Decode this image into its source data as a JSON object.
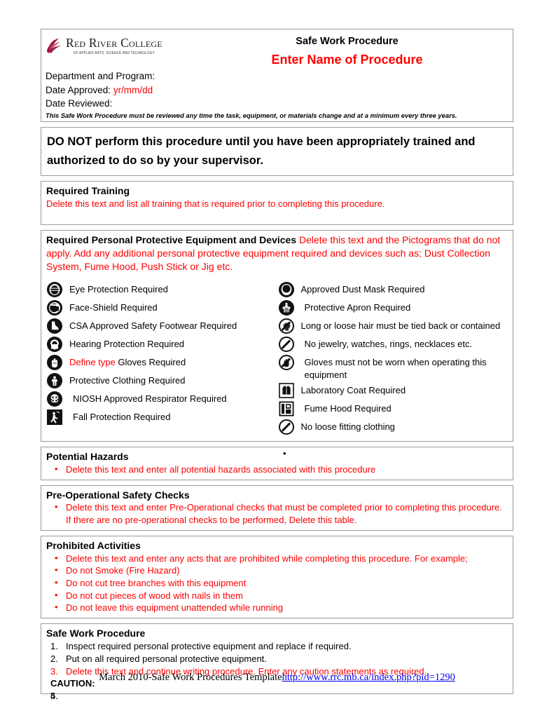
{
  "header": {
    "logo": {
      "name": "Red River College",
      "tagline": "OF APPLIED ARTS, SCIENCE AND TECHNOLOGY"
    },
    "title_main": "Safe Work Procedure",
    "title_sub": "Enter Name of Procedure",
    "department_label": "Department and Program:",
    "date_approved_label": "Date Approved:",
    "date_approved_value": "yr/mm/dd",
    "date_reviewed_label": "Date Reviewed:",
    "review_note": "This Safe Work Procedure must be reviewed any time the task, equipment, or materials change and at a minimum every three years."
  },
  "warning": {
    "text": "DO NOT perform this procedure until you have been appropriately trained and authorized to do so by your supervisor."
  },
  "required_training": {
    "heading": "Required Training",
    "body": "Delete this text and list all training that is required prior to completing this procedure."
  },
  "ppe": {
    "heading": "Required Personal Protective Equipment and Devices",
    "heading_note": "Delete this text and the Pictograms that do not apply.  Add any additional personal protective equipment required and devices such as; Dust Collection System, Fume Hood, Push Stick or Jig etc.",
    "left_items": [
      {
        "icon": "eye-protection-icon",
        "label": "Eye Protection Required"
      },
      {
        "icon": "face-shield-icon",
        "label": "Face-Shield Required"
      },
      {
        "icon": "safety-footwear-icon",
        "label": "CSA Approved Safety Footwear Required"
      },
      {
        "icon": "hearing-protection-icon",
        "label": "Hearing Protection Required"
      },
      {
        "icon": "gloves-required-icon",
        "label_red": "Define type",
        "label": " Gloves Required"
      },
      {
        "icon": "protective-clothing-icon",
        "label": "Protective Clothing Required"
      },
      {
        "icon": "respirator-icon",
        "label": "NIOSH Approved Respirator Required"
      },
      {
        "icon": "fall-protection-icon",
        "label": "Fall Protection Required"
      }
    ],
    "right_items": [
      {
        "icon": "dust-mask-icon",
        "label": "Approved Dust Mask Required"
      },
      {
        "icon": "protective-apron-icon",
        "label": "Protective Apron Required"
      },
      {
        "icon": "no-loose-hair-icon",
        "label": "Long or loose hair must be tied back or contained"
      },
      {
        "icon": "no-jewelry-icon",
        "label": "No jewelry, watches, rings, necklaces etc."
      },
      {
        "icon": "no-gloves-icon",
        "label": "Gloves must not be worn when  operating this equipment"
      },
      {
        "icon": "lab-coat-icon",
        "label": "Laboratory Coat Required"
      },
      {
        "icon": "fume-hood-icon",
        "label": "Fume Hood Required"
      },
      {
        "icon": "no-loose-clothing-icon",
        "label": "No loose fitting clothing"
      }
    ]
  },
  "potential_hazards": {
    "heading": "Potential Hazards",
    "stray_bullet": "•",
    "items": [
      "Delete this text and enter all potential hazards associated with this procedure"
    ]
  },
  "pre_operational": {
    "heading": "Pre-Operational Safety Checks",
    "items": [
      "Delete this text and enter Pre-Operational checks that must be completed prior to completing this procedure.  If there are no pre-operational checks to be performed, Delete this table."
    ]
  },
  "prohibited": {
    "heading": "Prohibited Activities",
    "items": [
      "Delete this text and enter any acts that are prohibited while completing this procedure.  For example;",
      "Do not Smoke (Fire Hazard)",
      "Do not cut tree branches with this equipment",
      "Do not cut pieces of wood with nails in them",
      "Do not leave this equipment unattended while running"
    ]
  },
  "procedure": {
    "heading": "Safe Work Procedure",
    "steps": [
      {
        "num": "1.",
        "text": "Inspect required personal protective equipment and replace if required.",
        "red": false
      },
      {
        "num": "2.",
        "text": "Put on all required personal protective equipment.",
        "red": false
      },
      {
        "num": "3.",
        "text": "Delete this text and continue writing procedure.  Enter any caution statements as required.",
        "red": true
      }
    ],
    "caution_label": "CAUTION:",
    "trailing_steps": [
      {
        "num": "4.",
        "text": ""
      },
      {
        "num": "5.",
        "text": ""
      }
    ]
  },
  "footer": {
    "text": "March 2010-Safe Work Procedures Template",
    "link": "http://www.rrc.mb.ca/index.php?pid=1290"
  },
  "colors": {
    "red": "#FF0000",
    "logo_red": "#A6123B",
    "border": "#9a9a9a",
    "text": "#000000"
  }
}
